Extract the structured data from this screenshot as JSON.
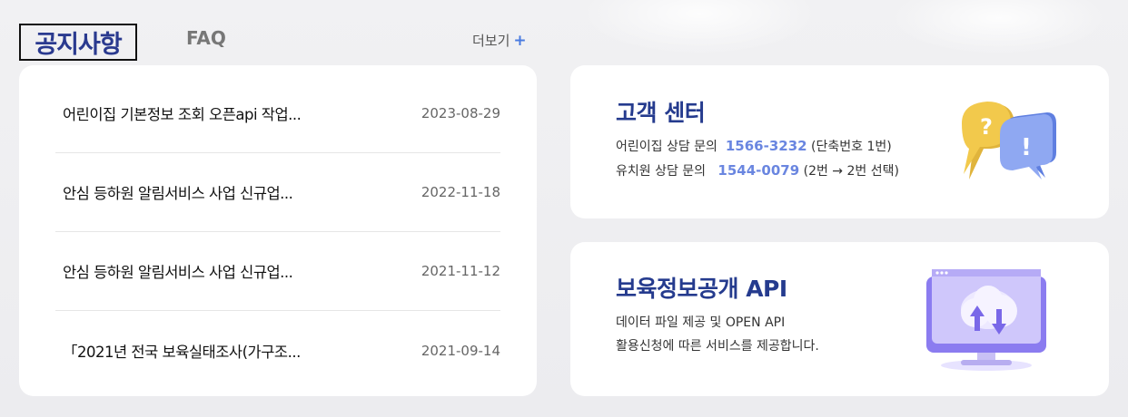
{
  "tabs": {
    "notice": "공지사항",
    "faq": "FAQ"
  },
  "more": {
    "label": "더보기",
    "plus": "+"
  },
  "notices": [
    {
      "title": "어린이집 기본정보 조회 오픈api 작업...",
      "date": "2023-08-29"
    },
    {
      "title": "안심 등하원 알림서비스 사업 신규업...",
      "date": "2022-11-18"
    },
    {
      "title": "안심 등하원 알림서비스 사업 신규업...",
      "date": "2021-11-12"
    },
    {
      "title": "「2021년 전국 보육실태조사(가구조...",
      "date": "2021-09-14"
    }
  ],
  "customer_center": {
    "title": "고객 센터",
    "line1_prefix": "어린이집 상담 문의",
    "line1_phone": "1566-3232",
    "line1_suffix": "(단축번호 1번)",
    "line2_prefix": "유치원 상담 문의",
    "line2_phone": "1544-0079",
    "line2_suffix": "(2번 → 2번 선택)"
  },
  "api_card": {
    "title": "보육정보공개 API",
    "line1": "데이터 파일 제공 및 OPEN API",
    "line2": "활용신청에 따른 서비스를 제공합니다."
  },
  "colors": {
    "accent_navy": "#253b8e",
    "phone_blue": "#6a86e0",
    "bubble_yellow": "#f2c94c",
    "bubble_blue": "#7f9df0",
    "monitor_purple": "#8b7cf0"
  },
  "icons": {
    "customer_center": "speech-bubbles-question-exclamation-icon",
    "api": "monitor-cloud-upload-download-icon"
  }
}
